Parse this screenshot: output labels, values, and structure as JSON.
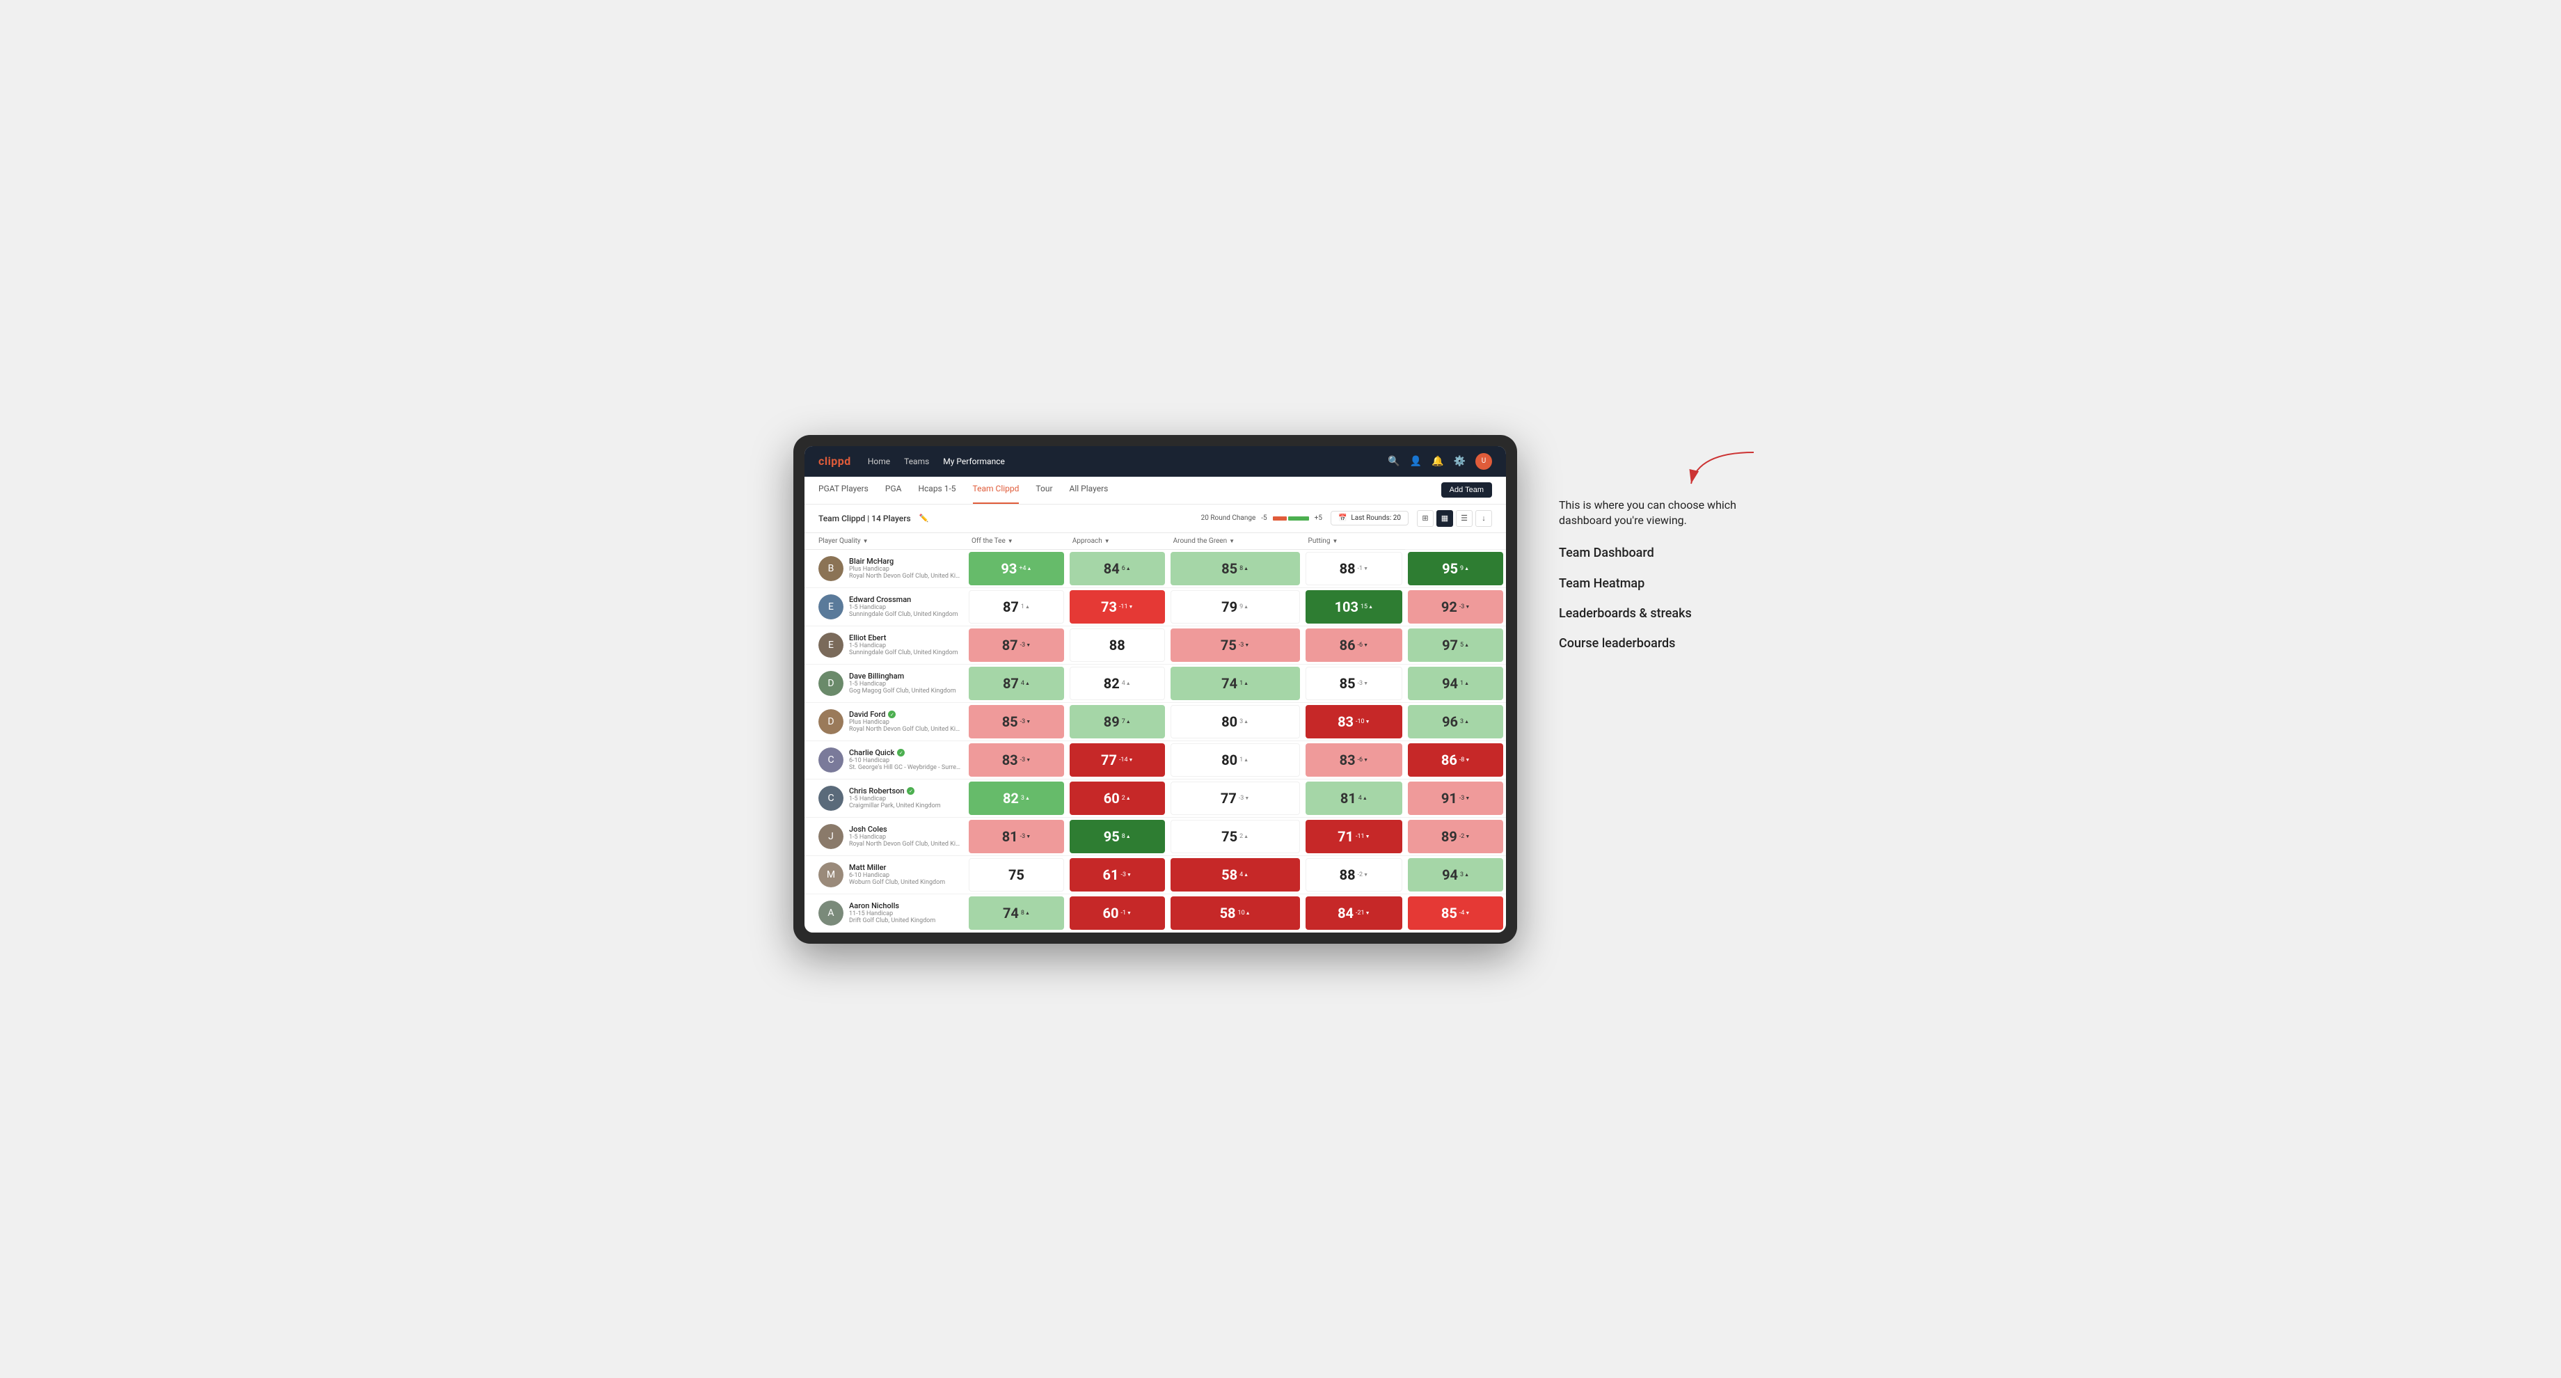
{
  "annotation": {
    "intro": "This is where you can choose which dashboard you're viewing.",
    "items": [
      "Team Dashboard",
      "Team Heatmap",
      "Leaderboards & streaks",
      "Course leaderboards"
    ]
  },
  "nav": {
    "logo": "clippd",
    "links": [
      "Home",
      "Teams",
      "My Performance"
    ],
    "active_link": "My Performance"
  },
  "sub_nav": {
    "links": [
      "PGAT Players",
      "PGA",
      "Hcaps 1-5",
      "Team Clippd",
      "Tour",
      "All Players"
    ],
    "active_link": "Team Clippd",
    "add_team_label": "Add Team"
  },
  "team_header": {
    "title": "Team Clippd",
    "player_count": "14 Players",
    "round_change_label": "20 Round Change",
    "change_low": "-5",
    "change_high": "+5",
    "last_rounds_label": "Last Rounds:",
    "last_rounds_value": "20"
  },
  "table": {
    "columns": [
      {
        "label": "Player Quality",
        "arrow": "▼",
        "key": "player_quality"
      },
      {
        "label": "Off the Tee",
        "arrow": "▼",
        "key": "off_tee"
      },
      {
        "label": "Approach",
        "arrow": "▼",
        "key": "approach"
      },
      {
        "label": "Around the Green",
        "arrow": "▼",
        "key": "around_green"
      },
      {
        "label": "Putting",
        "arrow": "▼",
        "key": "putting"
      }
    ],
    "players": [
      {
        "name": "Blair McHarg",
        "handicap": "Plus Handicap",
        "club": "Royal North Devon Golf Club, United Kingdom",
        "avatar_color": "#8B7355",
        "avatar_letter": "B",
        "verified": false,
        "player_quality": {
          "value": 93,
          "change": "+4",
          "dir": "up",
          "bg": "green-med"
        },
        "off_tee": {
          "value": 84,
          "change": "6",
          "dir": "up",
          "bg": "green-light"
        },
        "approach": {
          "value": 85,
          "change": "8",
          "dir": "up",
          "bg": "green-light"
        },
        "around_green": {
          "value": 88,
          "change": "-1",
          "dir": "down",
          "bg": "white"
        },
        "putting": {
          "value": 95,
          "change": "9",
          "dir": "up",
          "bg": "green-strong"
        }
      },
      {
        "name": "Edward Crossman",
        "handicap": "1-5 Handicap",
        "club": "Sunningdale Golf Club, United Kingdom",
        "avatar_color": "#5a7a9a",
        "avatar_letter": "E",
        "verified": false,
        "player_quality": {
          "value": 87,
          "change": "1",
          "dir": "up",
          "bg": "white"
        },
        "off_tee": {
          "value": 73,
          "change": "-11",
          "dir": "down",
          "bg": "red-med"
        },
        "approach": {
          "value": 79,
          "change": "9",
          "dir": "up",
          "bg": "white"
        },
        "around_green": {
          "value": 103,
          "change": "15",
          "dir": "up",
          "bg": "green-strong"
        },
        "putting": {
          "value": 92,
          "change": "-3",
          "dir": "down",
          "bg": "red-light"
        }
      },
      {
        "name": "Elliot Ebert",
        "handicap": "1-5 Handicap",
        "club": "Sunningdale Golf Club, United Kingdom",
        "avatar_color": "#7a6a5a",
        "avatar_letter": "E",
        "verified": false,
        "player_quality": {
          "value": 87,
          "change": "-3",
          "dir": "down",
          "bg": "red-light"
        },
        "off_tee": {
          "value": 88,
          "change": "",
          "dir": "",
          "bg": "white"
        },
        "approach": {
          "value": 75,
          "change": "-3",
          "dir": "down",
          "bg": "red-light"
        },
        "around_green": {
          "value": 86,
          "change": "-6",
          "dir": "down",
          "bg": "red-light"
        },
        "putting": {
          "value": 97,
          "change": "5",
          "dir": "up",
          "bg": "green-light"
        }
      },
      {
        "name": "Dave Billingham",
        "handicap": "1-5 Handicap",
        "club": "Gog Magog Golf Club, United Kingdom",
        "avatar_color": "#6a8a6a",
        "avatar_letter": "D",
        "verified": false,
        "player_quality": {
          "value": 87,
          "change": "4",
          "dir": "up",
          "bg": "green-light"
        },
        "off_tee": {
          "value": 82,
          "change": "4",
          "dir": "up",
          "bg": "white"
        },
        "approach": {
          "value": 74,
          "change": "1",
          "dir": "up",
          "bg": "green-light"
        },
        "around_green": {
          "value": 85,
          "change": "-3",
          "dir": "down",
          "bg": "white"
        },
        "putting": {
          "value": 94,
          "change": "1",
          "dir": "up",
          "bg": "green-light"
        }
      },
      {
        "name": "David Ford",
        "handicap": "Plus Handicap",
        "club": "Royal North Devon Golf Club, United Kingdom",
        "avatar_color": "#9a7a5a",
        "avatar_letter": "D",
        "verified": true,
        "player_quality": {
          "value": 85,
          "change": "-3",
          "dir": "down",
          "bg": "red-light"
        },
        "off_tee": {
          "value": 89,
          "change": "7",
          "dir": "up",
          "bg": "green-light"
        },
        "approach": {
          "value": 80,
          "change": "3",
          "dir": "up",
          "bg": "white"
        },
        "around_green": {
          "value": 83,
          "change": "-10",
          "dir": "down",
          "bg": "red-strong"
        },
        "putting": {
          "value": 96,
          "change": "3",
          "dir": "up",
          "bg": "green-light"
        }
      },
      {
        "name": "Charlie Quick",
        "handicap": "6-10 Handicap",
        "club": "St. George's Hill GC - Weybridge - Surrey, Uni...",
        "avatar_color": "#7a7a9a",
        "avatar_letter": "C",
        "verified": true,
        "player_quality": {
          "value": 83,
          "change": "-3",
          "dir": "down",
          "bg": "red-light"
        },
        "off_tee": {
          "value": 77,
          "change": "-14",
          "dir": "down",
          "bg": "red-strong"
        },
        "approach": {
          "value": 80,
          "change": "1",
          "dir": "up",
          "bg": "white"
        },
        "around_green": {
          "value": 83,
          "change": "-6",
          "dir": "down",
          "bg": "red-light"
        },
        "putting": {
          "value": 86,
          "change": "-8",
          "dir": "down",
          "bg": "red-strong"
        }
      },
      {
        "name": "Chris Robertson",
        "handicap": "1-5 Handicap",
        "club": "Craigmillar Park, United Kingdom",
        "avatar_color": "#5a6a7a",
        "avatar_letter": "C",
        "verified": true,
        "player_quality": {
          "value": 82,
          "change": "3",
          "dir": "up",
          "bg": "green-med"
        },
        "off_tee": {
          "value": 60,
          "change": "2",
          "dir": "up",
          "bg": "red-strong"
        },
        "approach": {
          "value": 77,
          "change": "-3",
          "dir": "down",
          "bg": "white"
        },
        "around_green": {
          "value": 81,
          "change": "4",
          "dir": "up",
          "bg": "green-light"
        },
        "putting": {
          "value": 91,
          "change": "-3",
          "dir": "down",
          "bg": "red-light"
        }
      },
      {
        "name": "Josh Coles",
        "handicap": "1-5 Handicap",
        "club": "Royal North Devon Golf Club, United Kingdom",
        "avatar_color": "#8a7a6a",
        "avatar_letter": "J",
        "verified": false,
        "player_quality": {
          "value": 81,
          "change": "-3",
          "dir": "down",
          "bg": "red-light"
        },
        "off_tee": {
          "value": 95,
          "change": "8",
          "dir": "up",
          "bg": "green-strong"
        },
        "approach": {
          "value": 75,
          "change": "2",
          "dir": "up",
          "bg": "white"
        },
        "around_green": {
          "value": 71,
          "change": "-11",
          "dir": "down",
          "bg": "red-strong"
        },
        "putting": {
          "value": 89,
          "change": "-2",
          "dir": "down",
          "bg": "red-light"
        }
      },
      {
        "name": "Matt Miller",
        "handicap": "6-10 Handicap",
        "club": "Woburn Golf Club, United Kingdom",
        "avatar_color": "#9a8a7a",
        "avatar_letter": "M",
        "verified": false,
        "player_quality": {
          "value": 75,
          "change": "",
          "dir": "",
          "bg": "white"
        },
        "off_tee": {
          "value": 61,
          "change": "-3",
          "dir": "down",
          "bg": "red-strong"
        },
        "approach": {
          "value": 58,
          "change": "4",
          "dir": "up",
          "bg": "red-strong"
        },
        "around_green": {
          "value": 88,
          "change": "-2",
          "dir": "down",
          "bg": "white"
        },
        "putting": {
          "value": 94,
          "change": "3",
          "dir": "up",
          "bg": "green-light"
        }
      },
      {
        "name": "Aaron Nicholls",
        "handicap": "11-15 Handicap",
        "club": "Drift Golf Club, United Kingdom",
        "avatar_color": "#7a8a7a",
        "avatar_letter": "A",
        "verified": false,
        "player_quality": {
          "value": 74,
          "change": "8",
          "dir": "up",
          "bg": "green-light"
        },
        "off_tee": {
          "value": 60,
          "change": "-1",
          "dir": "down",
          "bg": "red-strong"
        },
        "approach": {
          "value": 58,
          "change": "10",
          "dir": "up",
          "bg": "red-strong"
        },
        "around_green": {
          "value": 84,
          "change": "-21",
          "dir": "down",
          "bg": "red-strong"
        },
        "putting": {
          "value": 85,
          "change": "-4",
          "dir": "down",
          "bg": "red-med"
        }
      }
    ]
  }
}
